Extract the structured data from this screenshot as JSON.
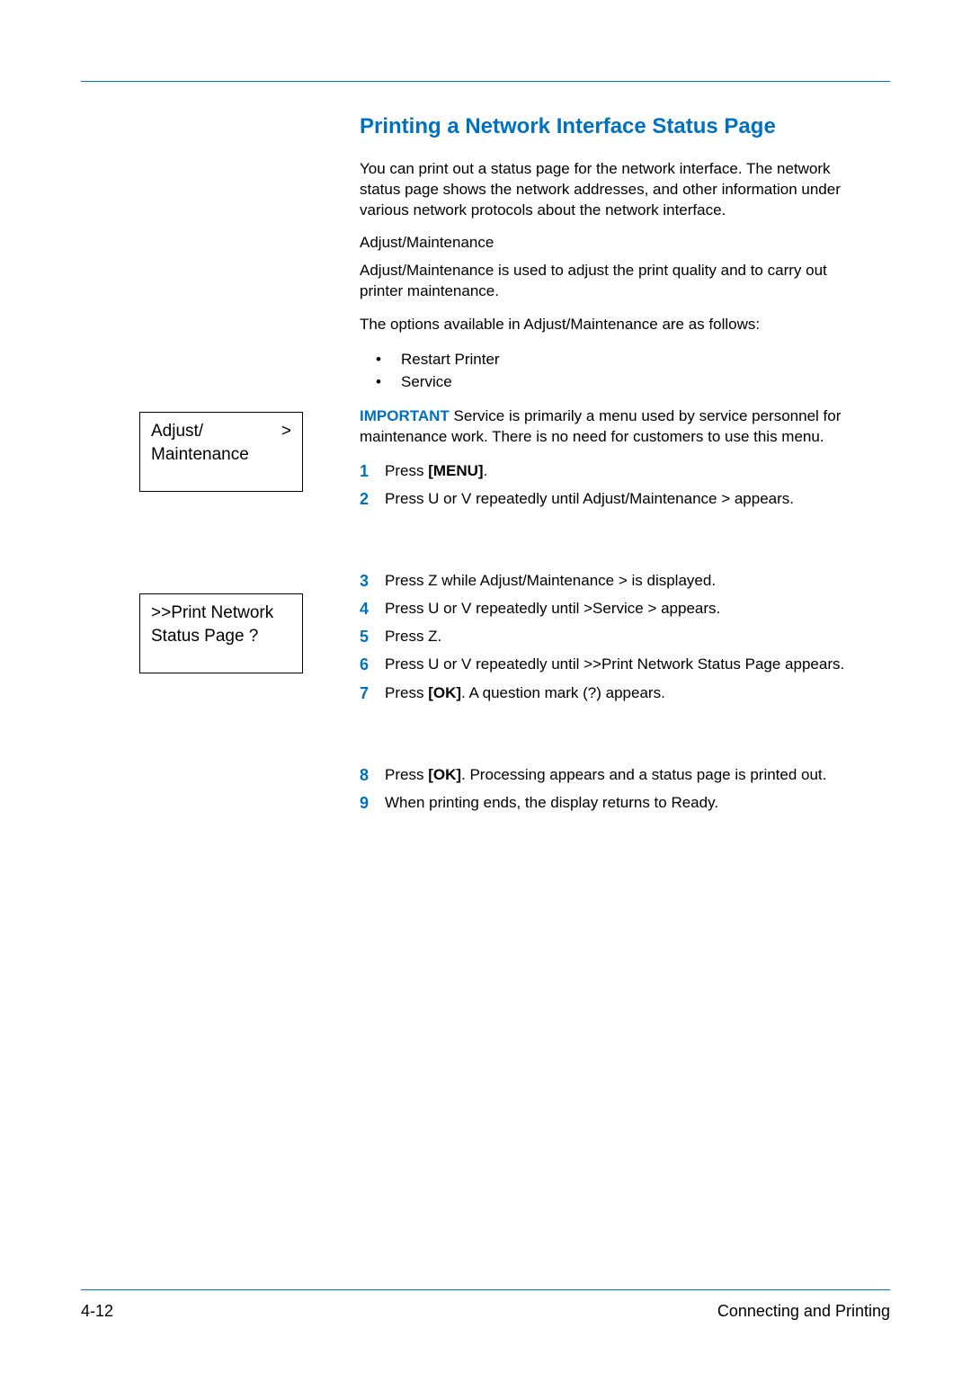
{
  "title": "Printing a Network Interface Status Page",
  "intro": "You can print out a status page for the network interface. The network status page shows the network addresses, and other information under various network protocols about the network interface.",
  "subhead": "Adjust/Maintenance",
  "subdesc": "Adjust/Maintenance is used to adjust the print quality and to carry out printer maintenance.",
  "optsline": "The options available in Adjust/Maintenance are as follows:",
  "opts": [
    "Restart Printer",
    "Service"
  ],
  "important_label": "IMPORTANT",
  "important_text": "Service   is primarily a menu used by service personnel for maintenance work. There is no need for customers to use this menu.",
  "steps": {
    "s1a": "Press ",
    "s1b": "[MENU]",
    "s1c": ".",
    "s2": "Press  U or  V repeatedly until Adjust/Maintenance >      appears.",
    "s3": "Press  Z while Adjust/Maintenance >      is displayed.",
    "s4": "Press  U or  V repeatedly until >Service >    appears.",
    "s5": "Press  Z.",
    "s6": "Press  U or  V repeatedly until >>Print Network Status Page appears.",
    "s7a": "Press ",
    "s7b": "[OK]",
    "s7c": ". A question mark (?) appears.",
    "s8a": "Press ",
    "s8b": "[OK]",
    "s8c": ". Processing    appears and a status page is printed out.",
    "s9": "When printing ends, the display returns to Ready."
  },
  "step_nums": {
    "n1": "1",
    "n2": "2",
    "n3": "3",
    "n4": "4",
    "n5": "5",
    "n6": "6",
    "n7": "7",
    "n8": "8",
    "n9": "9"
  },
  "box1": {
    "line1a": "Adjust/",
    "line1b": ">",
    "line2": "Maintenance"
  },
  "box2": {
    "line1": ">>Print Network",
    "line2": " Status Page ?"
  },
  "footer": {
    "left": "4-12",
    "right": "Connecting and Printing"
  }
}
